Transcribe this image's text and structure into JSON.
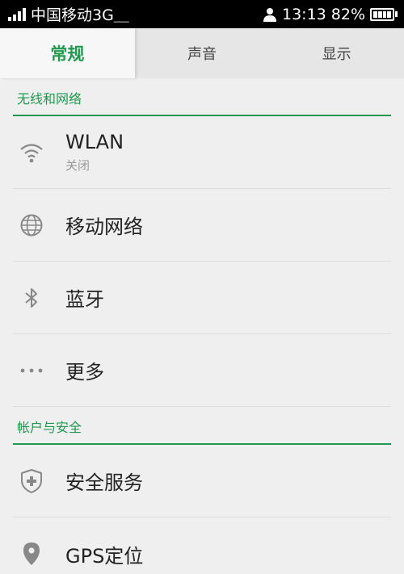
{
  "status_bar": {
    "carrier": "中国移动3G＿",
    "time": "13:13",
    "battery": "82%"
  },
  "tabs": [
    {
      "label": "常规",
      "active": true
    },
    {
      "label": "声音",
      "active": false
    },
    {
      "label": "显示",
      "active": false
    }
  ],
  "sections": [
    {
      "header": "无线和网络",
      "items": [
        {
          "label": "WLAN",
          "sub": "关闭",
          "icon": "wifi-icon"
        },
        {
          "label": "移动网络",
          "icon": "globe-icon"
        },
        {
          "label": "蓝牙",
          "icon": "bluetooth-icon"
        },
        {
          "label": "更多",
          "icon": "more-icon"
        }
      ]
    },
    {
      "header": "帐户与安全",
      "items": [
        {
          "label": "安全服务",
          "icon": "shield-icon"
        },
        {
          "label": "GPS定位",
          "icon": "location-pin-icon"
        }
      ]
    }
  ],
  "colors": {
    "accent": "#1f9a4f",
    "background": "#efefef",
    "statusbar": "#000000"
  }
}
